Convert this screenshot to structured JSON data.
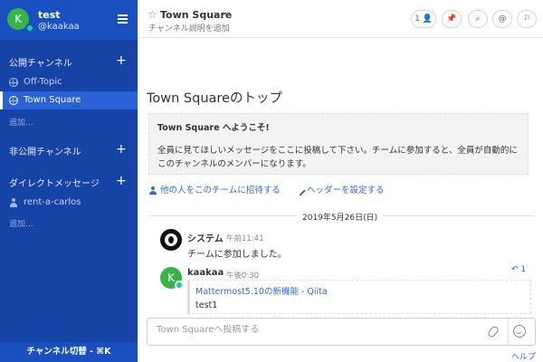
{
  "sidebar": {
    "team_initial": "K",
    "team_name": "test",
    "username": "@kaakaa",
    "public_channels_title": "公開チャンネル",
    "public_channels": [
      {
        "label": "Off-Topic"
      },
      {
        "label": "Town Square"
      }
    ],
    "public_more": "追加...",
    "private_channels_title": "非公開チャンネル",
    "direct_messages_title": "ダイレクトメッセージ",
    "direct_messages": [
      {
        "label": "rent-a-carlos"
      }
    ],
    "dm_more": "追加...",
    "switcher_label": "チャンネル切替 - ⌘K",
    "add_symbol": "+"
  },
  "header": {
    "channel_name": "Town Square",
    "purpose": "チャンネル説明を追加",
    "member_count": "1"
  },
  "intro": {
    "title": "Town Squareのトップ",
    "welcome": "Town Square へようこそ!",
    "body": "全員に見てほしいメッセージをここに投稿して下さい。チームに参加すると、全員が自動的にこのチャンネルのメンバーになります。",
    "invite_link": "他の人をこのチームに招待する",
    "header_link": "ヘッダーを設定する"
  },
  "date_separator": "2019年5月26日(日)",
  "posts": [
    {
      "user": "システム",
      "time": "午前11:41",
      "text": "チームに参加しました。"
    },
    {
      "user": "kaakaa",
      "time": "午後0:30",
      "avatar_initial": "K",
      "reply_count": "1",
      "link": "Mattermost5.10の新機能 - Qiita",
      "text": "test1"
    }
  ],
  "composer": {
    "placeholder": "Town Squareへ投稿する"
  },
  "help_label": "ヘルプ",
  "colors": {
    "sidebar_bg": "#1543a6",
    "accent": "#2d6ad9",
    "online": "#06d6a0"
  }
}
